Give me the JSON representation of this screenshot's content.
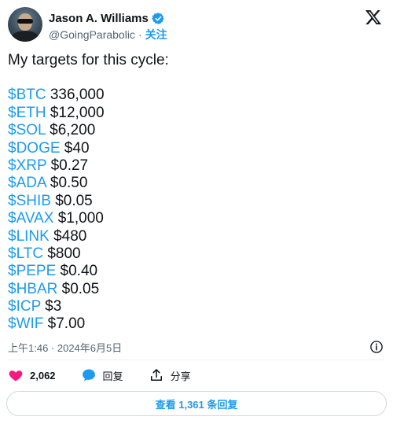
{
  "author": {
    "display_name": "Jason A. Williams",
    "handle": "@GoingParabolic",
    "separator": "·",
    "follow_label": "关注"
  },
  "tweet": {
    "intro": "My targets for this cycle:",
    "targets": [
      {
        "ticker": "$BTC",
        "price": " 336,000"
      },
      {
        "ticker": "$ETH",
        "price": " $12,000"
      },
      {
        "ticker": "$SOL",
        "price": " $6,200"
      },
      {
        "ticker": "$DOGE",
        "price": " $40"
      },
      {
        "ticker": "$XRP",
        "price": " $0.27"
      },
      {
        "ticker": "$ADA",
        "price": " $0.50"
      },
      {
        "ticker": "$SHIB",
        "price": " $0.05"
      },
      {
        "ticker": "$AVAX",
        "price": " $1,000"
      },
      {
        "ticker": "$LINK",
        "price": " $480"
      },
      {
        "ticker": "$LTC",
        "price": " $800"
      },
      {
        "ticker": "$PEPE",
        "price": " $0.40"
      },
      {
        "ticker": "$HBAR",
        "price": " $0.05"
      },
      {
        "ticker": "$ICP",
        "price": " $3"
      },
      {
        "ticker": "$WIF",
        "price": " $7.00"
      }
    ],
    "timestamp": "上午1:46 · 2024年6月5日"
  },
  "actions": {
    "likes": "2,062",
    "reply_label": "回复",
    "share_label": "分享"
  },
  "replies_button": "查看 1,361 条回复",
  "colors": {
    "accent": "#1d9bf0",
    "like": "#f91880",
    "text": "#0f1419",
    "muted": "#536471"
  },
  "icons": {
    "verified": "verified-badge-icon",
    "brand": "x-logo-icon",
    "info": "info-icon",
    "like": "heart-icon",
    "reply": "speech-bubble-icon",
    "share": "share-icon"
  }
}
